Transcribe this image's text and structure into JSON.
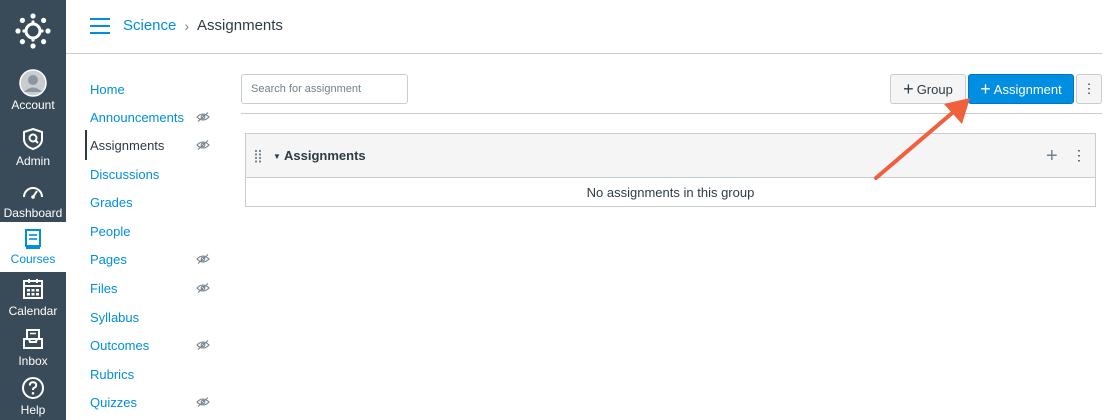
{
  "global_nav": {
    "items": [
      {
        "label": "Account",
        "icon": "account-icon"
      },
      {
        "label": "Admin",
        "icon": "admin-icon"
      },
      {
        "label": "Dashboard",
        "icon": "dashboard-icon"
      },
      {
        "label": "Courses",
        "icon": "courses-icon",
        "active": true
      },
      {
        "label": "Calendar",
        "icon": "calendar-icon"
      },
      {
        "label": "Inbox",
        "icon": "inbox-icon"
      },
      {
        "label": "Help",
        "icon": "help-icon"
      }
    ],
    "bg_color": "#394b58",
    "active_color": "#008ee2"
  },
  "header": {
    "breadcrumb": {
      "course": "Science",
      "separator": "›",
      "current": "Assignments"
    }
  },
  "course_nav": {
    "items": [
      {
        "label": "Home",
        "hidden": false
      },
      {
        "label": "Announcements",
        "hidden": true
      },
      {
        "label": "Assignments",
        "hidden": true,
        "active": true
      },
      {
        "label": "Discussions",
        "hidden": false
      },
      {
        "label": "Grades",
        "hidden": false
      },
      {
        "label": "People",
        "hidden": false
      },
      {
        "label": "Pages",
        "hidden": true
      },
      {
        "label": "Files",
        "hidden": true
      },
      {
        "label": "Syllabus",
        "hidden": false
      },
      {
        "label": "Outcomes",
        "hidden": true
      },
      {
        "label": "Rubrics",
        "hidden": false
      },
      {
        "label": "Quizzes",
        "hidden": true
      }
    ]
  },
  "toolbar": {
    "search_placeholder": "Search for assignment",
    "group_label": "Group",
    "assignment_label": "Assignment",
    "more_label": "⋮"
  },
  "assignment_group": {
    "title": "Assignments",
    "empty_message": "No assignments in this group",
    "more_label": "⋮",
    "add_label": "+"
  },
  "colors": {
    "link": "#008ee2",
    "primary_button": "#008ee2",
    "annotation_arrow": "#f0603c"
  }
}
